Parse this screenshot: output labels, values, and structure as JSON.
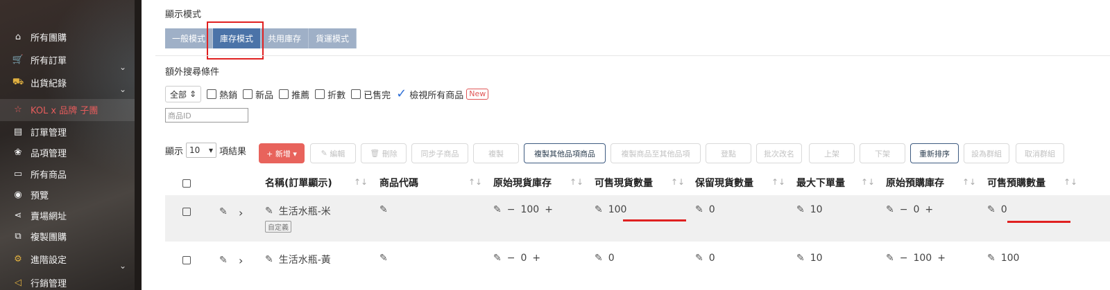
{
  "sidebar": {
    "items": [
      {
        "label": "所有團購",
        "icon": "home-icon"
      },
      {
        "label": "所有訂單",
        "icon": "cart-icon"
      },
      {
        "label": "出貨紀錄",
        "icon": "truck-icon"
      },
      {
        "label": "KOL x 品牌 子團",
        "icon": "star-icon"
      },
      {
        "label": "訂單管理",
        "icon": "clipboard-icon"
      },
      {
        "label": "品項管理",
        "icon": "gift-icon"
      },
      {
        "label": "所有商品",
        "icon": "box-icon"
      },
      {
        "label": "預覽",
        "icon": "eye-icon"
      },
      {
        "label": "賣場網址",
        "icon": "share-icon"
      },
      {
        "label": "複製團購",
        "icon": "copy-icon"
      },
      {
        "label": "進階設定",
        "icon": "gear-icon"
      },
      {
        "label": "行銷管理",
        "icon": "megaphone-icon"
      }
    ]
  },
  "display_mode": {
    "label": "顯示模式",
    "modes": [
      "一般模式",
      "庫存模式",
      "共用庫存",
      "貨運模式"
    ],
    "active": "庫存模式"
  },
  "filters": {
    "label": "額外搜尋條件",
    "select_value": "全部",
    "checkboxes": [
      "熱銷",
      "新品",
      "推薦",
      "折數",
      "已售完"
    ],
    "view_all_label": "檢視所有商品",
    "new_badge": "New",
    "id_placeholder": "商品ID"
  },
  "toolbar": {
    "show_label": "顯示",
    "per_page": "10",
    "results_label": "項結果",
    "buttons": {
      "add": "+ 新增 ▾",
      "edit": "編輯",
      "delete": "刪除",
      "sync": "同步子商品",
      "copy": "複製",
      "copy_other": "複製其他品項商品",
      "copy_to_other": "複製商品至其他品項",
      "list": "登點",
      "rename": "批次改名",
      "publish": "上架",
      "unpublish": "下架",
      "reorder": "重新排序",
      "set_group": "設為群組",
      "cancel_group": "取消群組"
    }
  },
  "table": {
    "columns": [
      "名稱(訂單顯示)",
      "商品代碼",
      "原始現貨庫存",
      "可售現貨數量",
      "保留現貨數量",
      "最大下單量",
      "原始預購庫存",
      "可售預購數量"
    ],
    "rows": [
      {
        "name": "生活水瓶-米",
        "tag": "自定義",
        "orig_stock": "100",
        "sellable_stock": "100",
        "reserved": "0",
        "max_order": "10",
        "orig_preorder": "0",
        "sellable_preorder": "0"
      },
      {
        "name": "生活水瓶-黃",
        "tag": "",
        "orig_stock": "0",
        "sellable_stock": "0",
        "reserved": "0",
        "max_order": "10",
        "orig_preorder": "100",
        "sellable_preorder": "100"
      }
    ]
  },
  "colors": {
    "accent": "#4b73a8",
    "mode_inactive": "#9fb0c7",
    "add_button": "#e8635c",
    "highlight": "#e02020"
  }
}
